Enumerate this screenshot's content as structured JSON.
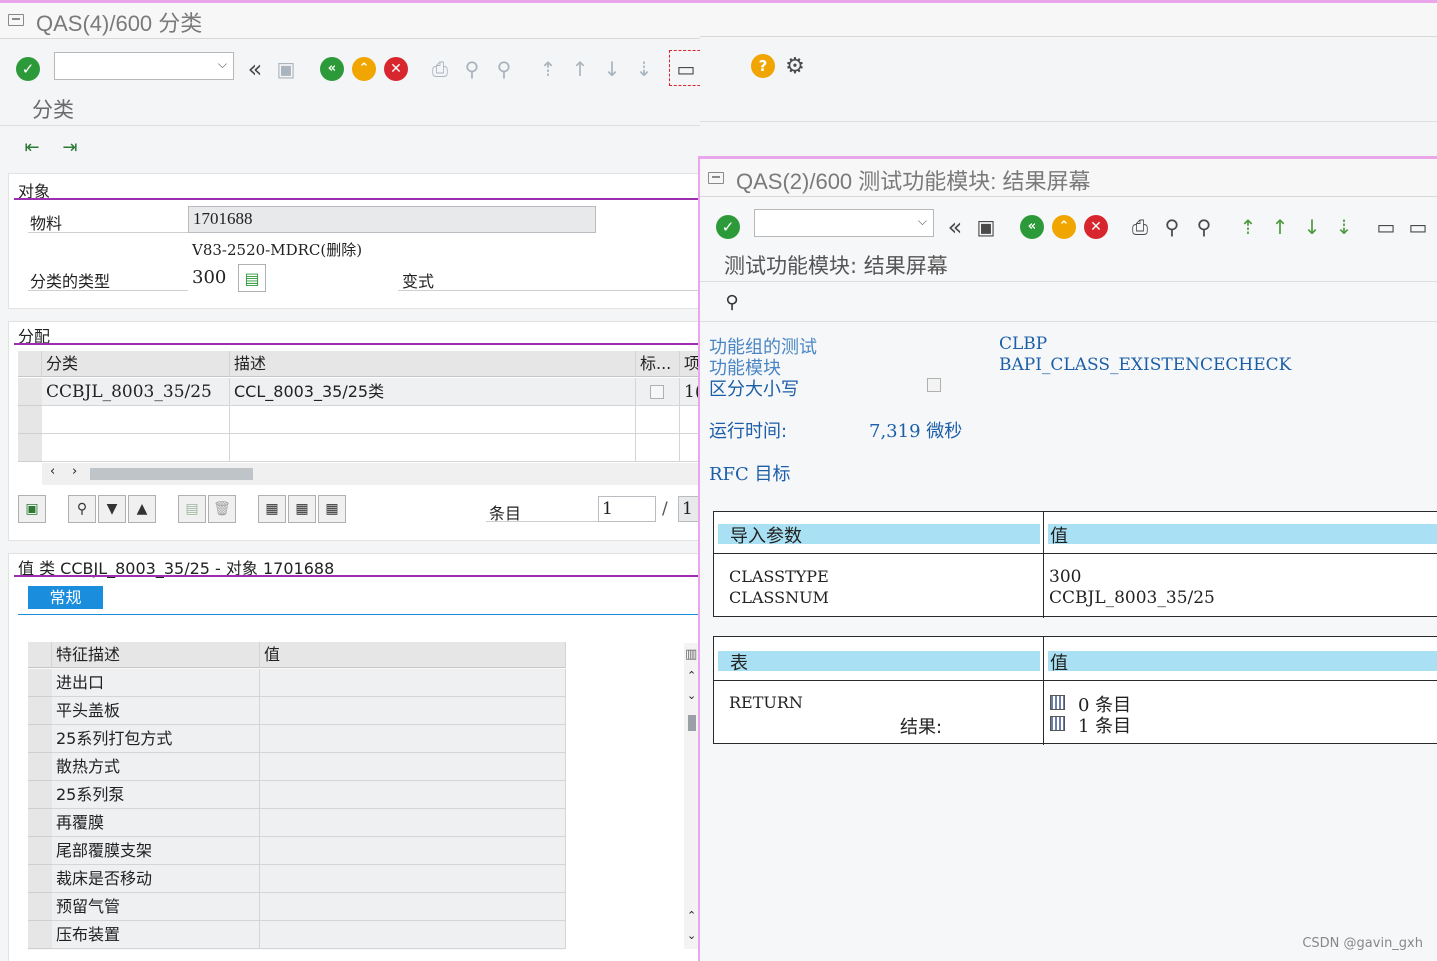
{
  "left_window": {
    "title": "QAS(4)/600  分类",
    "screen_title": "分类",
    "object_section": {
      "title": "对象",
      "material_label": "物料",
      "material_value": "1701688",
      "material_desc": "V83-2520-MDRC(删除)",
      "class_type_label": "分类的类型",
      "class_type_value": "300",
      "variant_label": "变式"
    },
    "assignment_section": {
      "title": "分配",
      "columns": [
        "分类",
        "描述",
        "标...",
        "项"
      ],
      "rows": [
        {
          "class": "CCBJL_8003_35/25",
          "desc": "CCL_8003_35/25类",
          "item": "1("
        }
      ],
      "entry_label": "条目",
      "entry_value": "1",
      "entry_sep": "/",
      "entry_total": "1"
    },
    "values_section": {
      "title": "值 类 CCBJL_8003_35/25 - 对象 1701688",
      "tab": "常规",
      "columns": [
        "特征描述",
        "值"
      ],
      "rows": [
        "进出口",
        "平头盖板",
        "25系列打包方式",
        "散热方式",
        "25系列泵",
        "再覆膜",
        "尾部覆膜支架",
        "裁床是否移动",
        "预留气管",
        "压布装置"
      ]
    }
  },
  "right_window": {
    "title": "QAS(2)/600 测试功能模块: 结果屏幕",
    "screen_title": "测试功能模块: 结果屏幕",
    "info": {
      "group_label": "功能组的测试",
      "group_value": "CLBP",
      "module_label": "功能模块",
      "module_value": "BAPI_CLASS_EXISTENCECHECK",
      "case_label": "区分大小写",
      "runtime_label": "运行时间:",
      "runtime_value": "7,319 微秒",
      "rfc_label": "RFC 目标"
    },
    "import_table": {
      "header_left": "导入参数",
      "header_right": "值",
      "params": [
        "CLASSTYPE",
        "CLASSNUM"
      ],
      "values": [
        "300",
        "CCBJL_8003_35/25"
      ]
    },
    "tables_table": {
      "header_left": "表",
      "header_right": "值",
      "name": "RETURN",
      "result_label": "结果:",
      "entries": [
        "0 条目",
        "1 条目"
      ]
    }
  },
  "watermark": "CSDN @gavin_gxh",
  "colors": {
    "accent_purple": "#9b2fb0",
    "pink_border": "#e9a6ea",
    "sap_blue_text": "#1c5fa8",
    "header_cyan": "#a9e0f3",
    "tab_blue": "#1a8ddc"
  }
}
